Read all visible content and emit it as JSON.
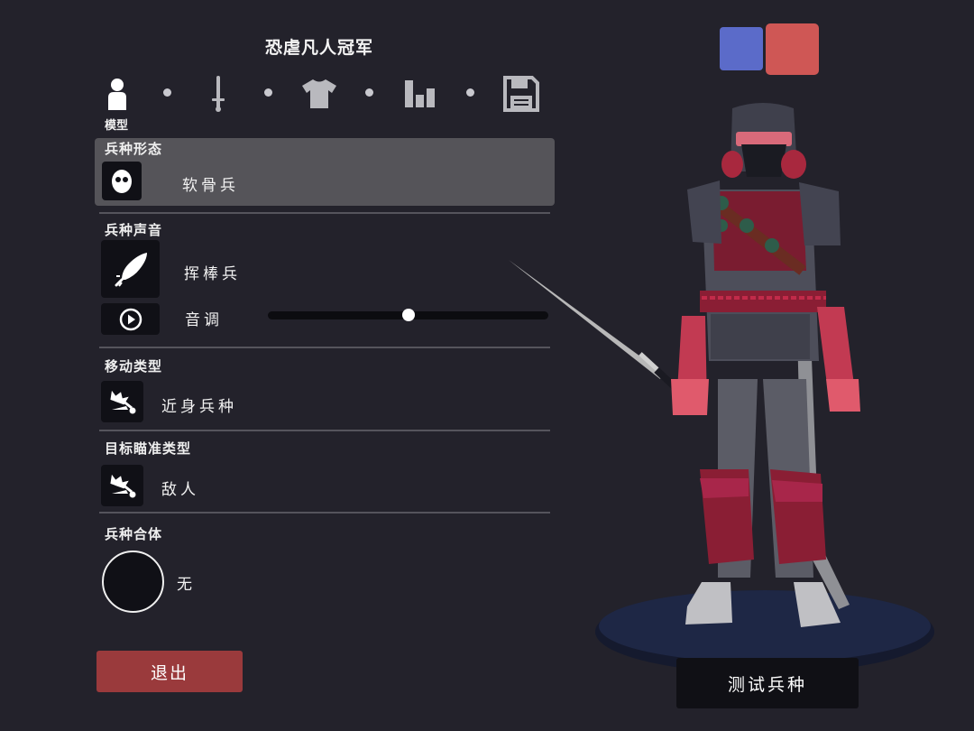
{
  "header": {
    "title": "恐虐凡人冠军"
  },
  "tabs": [
    {
      "name": "model",
      "label": "模型",
      "icon": "person-icon",
      "active": true
    },
    {
      "name": "weapon",
      "icon": "sword-icon"
    },
    {
      "name": "armor",
      "icon": "shirt-icon"
    },
    {
      "name": "stats",
      "icon": "bar-chart-icon"
    },
    {
      "name": "save",
      "icon": "floppy-disk-icon"
    }
  ],
  "sections": {
    "unit_base": {
      "title": "兵种形态",
      "value": "软骨兵",
      "icon": "face-icon"
    },
    "unit_voice": {
      "title": "兵种声音",
      "value": "挥棒兵",
      "icon": "feather-icon",
      "pitch_label": "音调",
      "pitch_value": 0.5,
      "play_icon": "play-icon"
    },
    "movement": {
      "title": "移动类型",
      "value": "近身兵种",
      "icon": "melee-crown-icon"
    },
    "targeting": {
      "title": "目标瞄准类型",
      "value": "敌人",
      "icon": "target-crown-icon"
    },
    "merge": {
      "title": "兵种合体",
      "value": "无"
    }
  },
  "buttons": {
    "exit": "退出",
    "test_unit": "测试兵种"
  },
  "teams": {
    "blue": "#5b6bc9",
    "red": "#cf5755"
  },
  "colors": {
    "background": "#23222b",
    "selected_row": "#555459",
    "exit_button": "#9a3a3c"
  }
}
